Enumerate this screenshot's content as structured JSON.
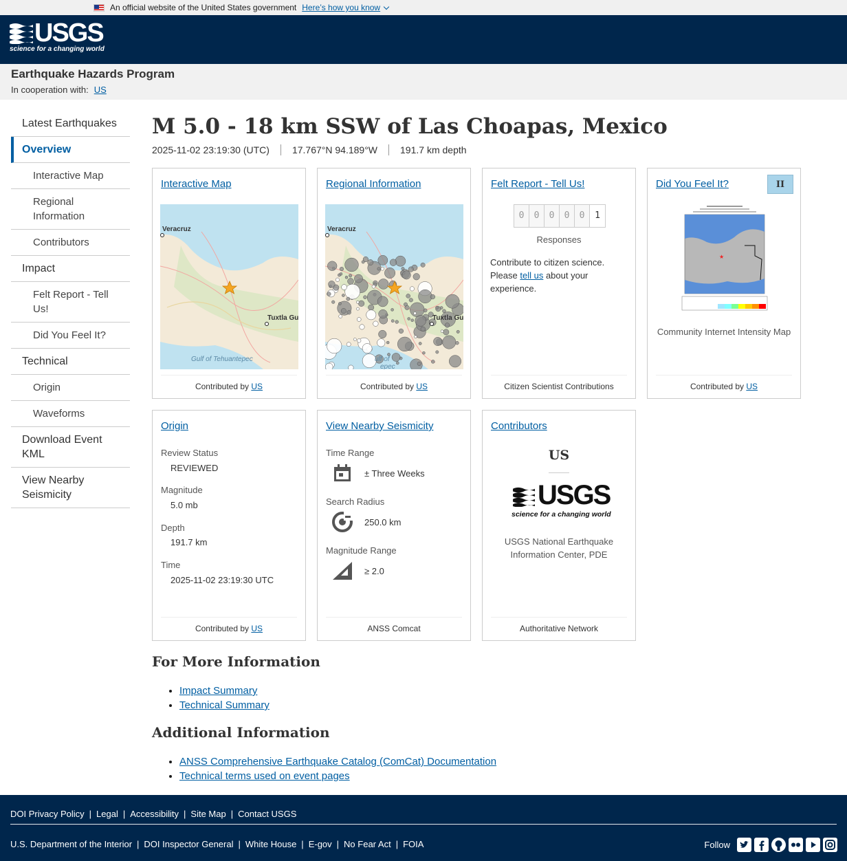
{
  "gov_banner": {
    "text": "An official website of the United States government",
    "link": "Here’s how you know"
  },
  "header": {
    "logo_word": "USGS",
    "logo_tag": "science for a changing world"
  },
  "program": {
    "title": "Earthquake Hazards Program",
    "coop_label": "In cooperation with:",
    "coop_link": "US"
  },
  "sidebar": {
    "items": [
      {
        "label": "Latest Earthquakes"
      },
      {
        "label": "Overview"
      },
      {
        "label": "Interactive Map"
      },
      {
        "label": "Regional Information"
      },
      {
        "label": "Contributors"
      },
      {
        "label": "Impact"
      },
      {
        "label": "Felt Report - Tell Us!"
      },
      {
        "label": "Did You Feel It?"
      },
      {
        "label": "Technical"
      },
      {
        "label": "Origin"
      },
      {
        "label": "Waveforms"
      },
      {
        "label": "Download Event KML"
      },
      {
        "label": "View Nearby Seismicity"
      }
    ]
  },
  "event": {
    "title": "M 5.0 - 18 km SSW of Las Choapas, Mexico",
    "time": "2025-11-02 23:19:30 (UTC)",
    "location": "17.767°N 94.189°W",
    "depth": "191.7 km depth"
  },
  "cards": {
    "map": {
      "title": "Interactive Map",
      "city1": "Veracruz",
      "city2": "Tuxtla Gu",
      "gulf": "Gulf of Tehuantepec",
      "contrib_prefix": "Contributed by",
      "contrib_link": "US"
    },
    "regional": {
      "title": "Regional Information",
      "city1": "Veracruz",
      "city2": "Tuxtla Gu",
      "gulf": "ulf of",
      "gulf2": "epec",
      "contrib_prefix": "Contributed by",
      "contrib_link": "US"
    },
    "felt": {
      "title": "Felt Report - Tell Us!",
      "digits": [
        "0",
        "0",
        "0",
        "0",
        "0",
        "1"
      ],
      "responses": "Responses",
      "text1": "Contribute to citizen science. Please ",
      "text_link": "tell us",
      "text2": " about your experience.",
      "footer": "Citizen Scientist Contributions"
    },
    "dyfi": {
      "title": "Did You Feel It?",
      "badge": "II",
      "caption": "Community Internet Intensity Map",
      "contrib_prefix": "Contributed by",
      "contrib_link": "US"
    },
    "origin": {
      "title": "Origin",
      "review_label": "Review Status",
      "review": "REVIEWED",
      "mag_label": "Magnitude",
      "mag": "5.0 mb",
      "depth_label": "Depth",
      "depth": "191.7 km",
      "time_label": "Time",
      "time": "2025-11-02 23:19:30 UTC",
      "contrib_prefix": "Contributed by",
      "contrib_link": "US"
    },
    "nearby": {
      "title": "View Nearby Seismicity",
      "range_label": "Time Range",
      "range": "± Three Weeks",
      "radius_label": "Search Radius",
      "radius": "250.0 km",
      "magrange_label": "Magnitude Range",
      "magrange": "≥ 2.0",
      "footer": "ANSS Comcat"
    },
    "contributors": {
      "title": "Contributors",
      "code": "US",
      "logo_word": "USGS",
      "logo_tag": "science for a changing world",
      "name": "USGS National Earthquake Information Center, PDE",
      "footer": "Authoritative Network"
    }
  },
  "more_info": {
    "heading": "For More Information",
    "links": [
      "Impact Summary",
      "Technical Summary"
    ]
  },
  "additional": {
    "heading": "Additional Information",
    "links": [
      "ANSS Comprehensive Earthquake Catalog (ComCat) Documentation",
      "Technical terms used on event pages"
    ]
  },
  "footer": {
    "row1": [
      "DOI Privacy Policy",
      "Legal",
      "Accessibility",
      "Site Map",
      "Contact USGS"
    ],
    "row2": [
      "U.S. Department of the Interior",
      "DOI Inspector General",
      "White House",
      "E-gov",
      "No Fear Act",
      "FOIA"
    ],
    "follow": "Follow",
    "social_icons": [
      "twitter-icon",
      "facebook-icon",
      "github-icon",
      "flickr-icon",
      "youtube-icon",
      "instagram-icon"
    ]
  }
}
